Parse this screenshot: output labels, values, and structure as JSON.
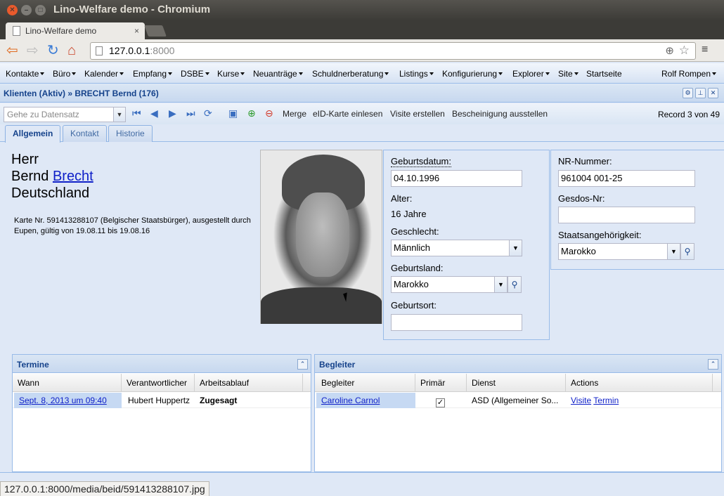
{
  "window": {
    "title": "Lino-Welfare demo - Chromium"
  },
  "browser": {
    "tab_title": "Lino-Welfare demo",
    "url_host": "127.0.0.1",
    "url_port": ":8000",
    "status_url": "127.0.0.1:8000/media/beid/591413288107.jpg"
  },
  "menu": [
    "Kontakte",
    "Büro",
    "Kalender",
    "Empfang",
    "DSBE",
    "Kurse",
    "Neuanträge",
    "Schuldnerberatung",
    "Listings",
    "Konfigurierung",
    "Explorer",
    "Site"
  ],
  "menu_home": "Startseite",
  "menu_user": "Rolf Rompen",
  "panel_title": "Klienten (Aktiv) » BRECHT Bernd (176)",
  "toolbar": {
    "goto_placeholder": "Gehe zu Datensatz",
    "actions": [
      "Merge",
      "eID-Karte einlesen",
      "Visite erstellen",
      "Bescheinigung ausstellen"
    ],
    "record_info": "Record 3 von 49"
  },
  "tabs": [
    "Allgemein",
    "Kontakt",
    "Historie"
  ],
  "person": {
    "salutation": "Herr",
    "first_name": "Bernd",
    "last_name": "Brecht",
    "country": "Deutschland",
    "card_text": "Karte Nr. 591413288107 (Belgischer Staatsbürger), ausgestellt durch Eupen, gültig von 19.08.11 bis 19.08.16"
  },
  "form": {
    "birth_date_label": "Geburtsdatum:",
    "birth_date": "04.10.1996",
    "age_label": "Alter:",
    "age": "16 Jahre",
    "gender_label": "Geschlecht:",
    "gender": "Männlich",
    "birth_country_label": "Geburtsland:",
    "birth_country": "Marokko",
    "birth_place_label": "Geburtsort:",
    "birth_place": "",
    "nr_label": "NR-Nummer:",
    "nr": "961004 001-25",
    "gesdos_label": "Gesdos-Nr:",
    "gesdos": "",
    "nationality_label": "Staatsangehörigkeit:",
    "nationality": "Marokko"
  },
  "termine": {
    "title": "Termine",
    "columns": [
      "Wann",
      "Verantwortlicher",
      "Arbeitsablauf"
    ],
    "rows": [
      {
        "wann": "Sept. 8, 2013 um 09:40",
        "verantwortlicher": "Hubert Huppertz",
        "arbeitsablauf": "Zugesagt"
      }
    ]
  },
  "begleiter": {
    "title": "Begleiter",
    "columns": [
      "Begleiter",
      "Primär",
      "Dienst",
      "Actions"
    ],
    "rows": [
      {
        "begleiter": "Caroline Carnol",
        "primaer": "✓",
        "dienst": "ASD (Allgemeiner So...",
        "action1": "Visite",
        "action2": "Termin"
      }
    ]
  }
}
